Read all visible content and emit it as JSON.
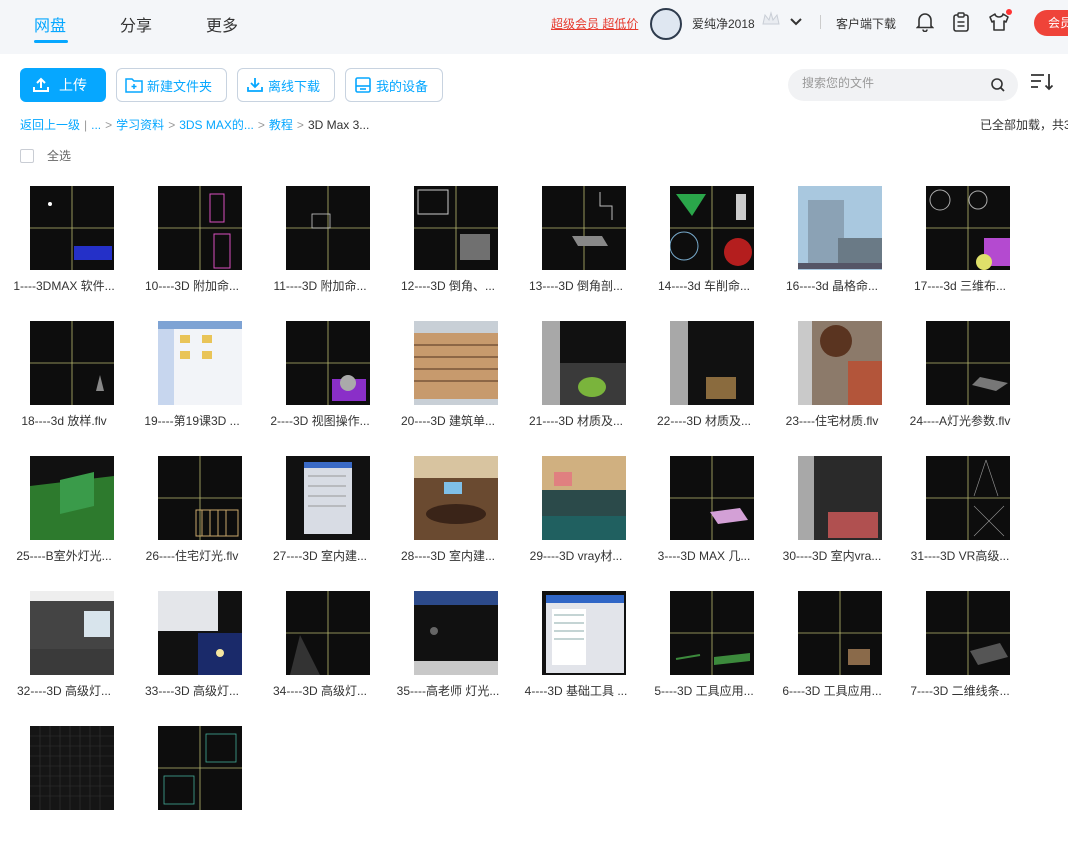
{
  "nav": {
    "tabs": [
      {
        "label": "网盘",
        "active": true
      },
      {
        "label": "分享",
        "active": false
      },
      {
        "label": "更多",
        "active": false
      }
    ]
  },
  "header": {
    "promo": "超级会员 超低价",
    "username": "爱纯净2018",
    "client_download": "客户端下载",
    "vip_button": "会员"
  },
  "toolbar": {
    "upload": "上传",
    "new_folder": "新建文件夹",
    "offline_download": "离线下载",
    "my_devices": "我的设备"
  },
  "search": {
    "placeholder": "搜索您的文件"
  },
  "breadcrumb": {
    "back": "返回上一级",
    "ellipsis": "...",
    "items": [
      "学习资料",
      "3DS MAX的...",
      "教程"
    ],
    "current": "3D Max 3..."
  },
  "loaded_text": "已全部加载，共3",
  "select_all": "全选",
  "colors": {
    "accent": "#06a7ff",
    "promo": "#e63a2e",
    "vip": "#ef4339"
  },
  "files": [
    {
      "name": "1----3DMAX 软件...",
      "thumb": "viewport-blue"
    },
    {
      "name": "10----3D 附加命...",
      "thumb": "viewport-door"
    },
    {
      "name": "11----3D 附加命...",
      "thumb": "viewport-frame"
    },
    {
      "name": "12----3D 倒角、...",
      "thumb": "viewport-box"
    },
    {
      "name": "13----3D 倒角剖...",
      "thumb": "viewport-plane"
    },
    {
      "name": "14----3d 车削命...",
      "thumb": "viewport-vase"
    },
    {
      "name": "16----3d 晶格命...",
      "thumb": "photo-building"
    },
    {
      "name": "17----3d 三维布...",
      "thumb": "viewport-purple"
    },
    {
      "name": "18----3d 放样.flv",
      "thumb": "viewport-dark"
    },
    {
      "name": "19----第19课3D ...",
      "thumb": "explorer-window"
    },
    {
      "name": "2----3D 视图操作...",
      "thumb": "viewport-teapot-purple"
    },
    {
      "name": "20----3D 建筑单...",
      "thumb": "photo-apartment"
    },
    {
      "name": "21----3D 材质及...",
      "thumb": "editor-teapot"
    },
    {
      "name": "22----3D 材质及...",
      "thumb": "editor-house"
    },
    {
      "name": "23----住宅材质.flv",
      "thumb": "material-brick"
    },
    {
      "name": "24----A灯光参数.flv",
      "thumb": "viewport-light"
    },
    {
      "name": "25----B室外灯光...",
      "thumb": "green-box"
    },
    {
      "name": "26----住宅灯光.flv",
      "thumb": "viewport-fence"
    },
    {
      "name": "27----3D 室内建...",
      "thumb": "dialog-window"
    },
    {
      "name": "28----3D 室内建...",
      "thumb": "photo-meeting"
    },
    {
      "name": "29----3D vray材...",
      "thumb": "photo-office"
    },
    {
      "name": "3----3D MAX 几...",
      "thumb": "viewport-pink-box"
    },
    {
      "name": "30----3D 室内vra...",
      "thumb": "editor-room"
    },
    {
      "name": "31----3D VR高级...",
      "thumb": "viewport-lines"
    },
    {
      "name": "32----3D 高级灯...",
      "thumb": "render-room"
    },
    {
      "name": "33----3D 高级灯...",
      "thumb": "dialog-blue"
    },
    {
      "name": "34----3D 高级灯...",
      "thumb": "viewport-spot"
    },
    {
      "name": "35----高老师 灯光...",
      "thumb": "editor-dark"
    },
    {
      "name": "4----3D 基础工具 ...",
      "thumb": "dialog-list"
    },
    {
      "name": "5----3D 工具应用...",
      "thumb": "viewport-green-plane"
    },
    {
      "name": "6----3D 工具应用...",
      "thumb": "viewport-small-box"
    },
    {
      "name": "7----3D 二维线条...",
      "thumb": "viewport-grid"
    },
    {
      "name": "",
      "thumb": "grid-mesh"
    },
    {
      "name": "",
      "thumb": "viewport-plan"
    }
  ]
}
